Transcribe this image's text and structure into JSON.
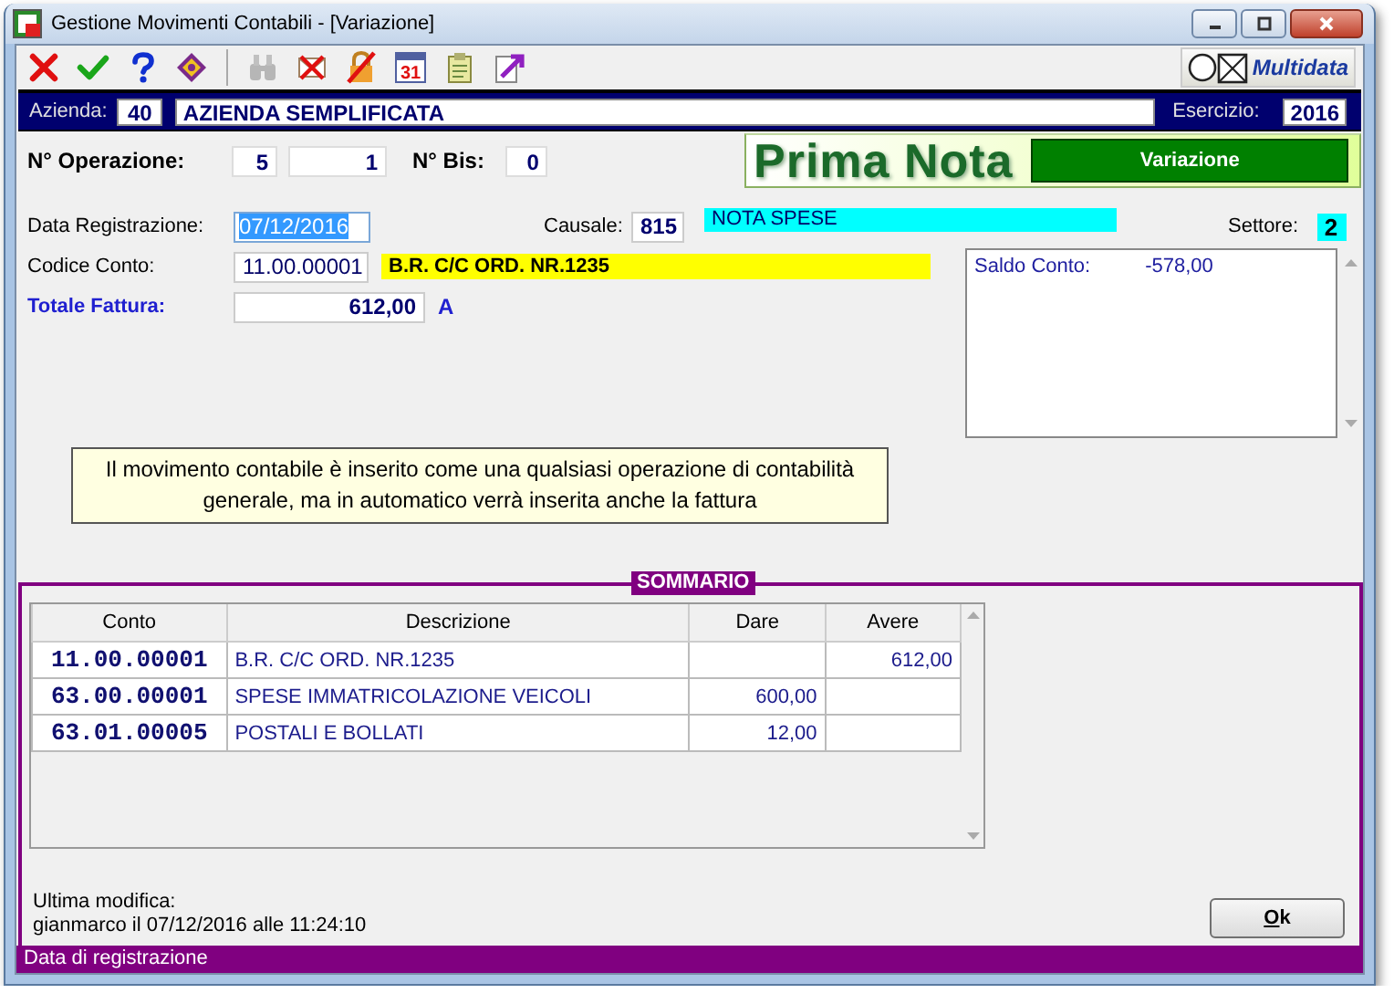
{
  "window": {
    "title": "Gestione Movimenti Contabili - [Variazione]"
  },
  "toolbar": [
    {
      "kind": "cancel",
      "disabled": false
    },
    {
      "kind": "confirm",
      "disabled": false
    },
    {
      "kind": "help",
      "disabled": false
    },
    {
      "kind": "manual",
      "disabled": false
    },
    {
      "kind": "search",
      "disabled": true
    },
    {
      "kind": "delete",
      "disabled": false
    },
    {
      "kind": "unlock",
      "disabled": false
    },
    {
      "kind": "calendar",
      "disabled": false,
      "label": "31"
    },
    {
      "kind": "clipboard",
      "disabled": false
    },
    {
      "kind": "export",
      "disabled": false
    }
  ],
  "logo": {
    "text": "Multidata"
  },
  "company_bar": {
    "label": "Azienda:",
    "code": "40",
    "name": "AZIENDA SEMPLIFICATA",
    "year_label": "Esercizio:",
    "year": "2016"
  },
  "operation": {
    "label": "N° Operazione:",
    "number": "5",
    "sub_number": "1",
    "bis_label": "N° Bis:",
    "bis": "0"
  },
  "banner": {
    "title": "Prima Nota",
    "mode": "Variazione"
  },
  "registration": {
    "date_label": "Data Registrazione:",
    "date": "07/12/2016",
    "date_focused": true,
    "causal_label": "Causale:",
    "causal_code": "815",
    "causal_description": "NOTA SPESE",
    "sector_label": "Settore:",
    "sector": "2"
  },
  "account": {
    "label": "Codice Conto:",
    "code": "11.00.00001",
    "description": "B.R. C/C ORD. NR.1235"
  },
  "invoice_total": {
    "label": "Totale Fattura:",
    "value": "612,00",
    "flag": "A"
  },
  "balance": {
    "label": "Saldo Conto:",
    "value": "-578,00"
  },
  "note": "Il movimento contabile è inserito come una qualsiasi operazione di contabilità generale, ma in automatico verrà inserita anche la fattura",
  "summary": {
    "title": "SOMMARIO",
    "columns": [
      "Conto",
      "Descrizione",
      "Dare",
      "Avere"
    ],
    "rows": [
      {
        "account": "11.00.00001",
        "description": "B.R. C/C ORD. NR.1235",
        "debit": "",
        "credit": "612,00"
      },
      {
        "account": "63.00.00001",
        "description": "SPESE IMMATRICOLAZIONE VEICOLI",
        "debit": "600,00",
        "credit": ""
      },
      {
        "account": "63.01.00005",
        "description": "POSTALI E BOLLATI",
        "debit": "12,00",
        "credit": ""
      }
    ]
  },
  "last_modified": {
    "label": "Ultima modifica:",
    "text": "gianmarco il 07/12/2016 alle 11:24:10"
  },
  "ok_button": "Ok",
  "status_bar": "Data di registrazione"
}
